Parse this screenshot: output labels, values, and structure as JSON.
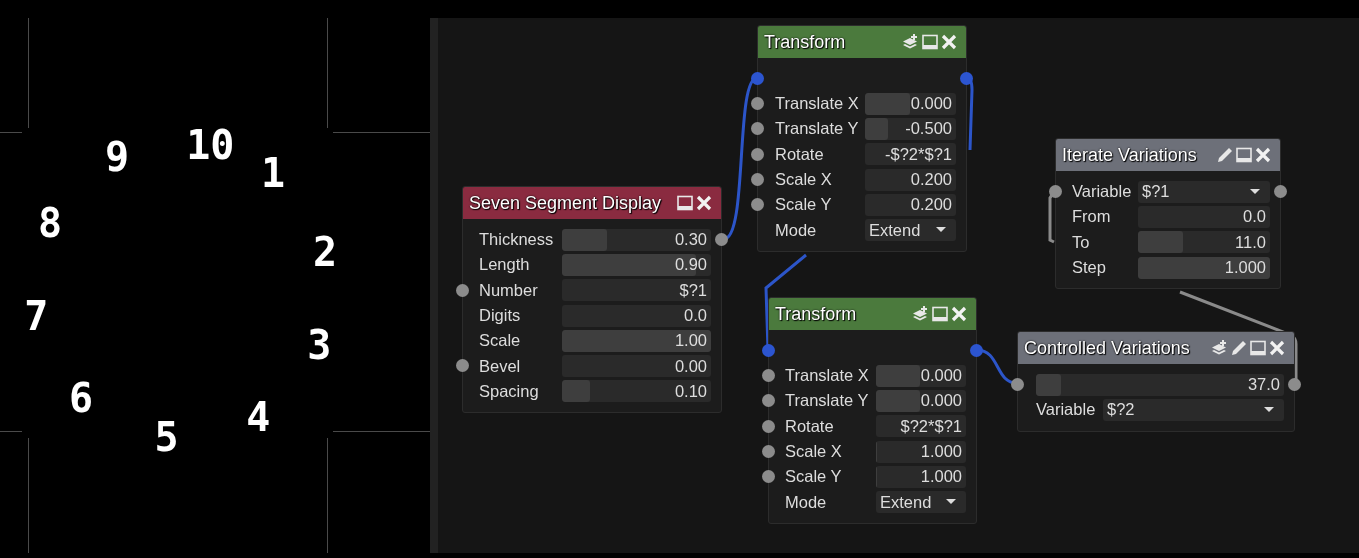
{
  "preview": {
    "digits": [
      "1",
      "2",
      "3",
      "4",
      "5",
      "6",
      "7",
      "8",
      "9",
      "10"
    ]
  },
  "nodes": [
    {
      "title": "Transform",
      "color": "#4b7a3d",
      "icons": [
        {
          "kind": "layers"
        },
        {
          "kind": "window"
        },
        {
          "kind": "close"
        }
      ],
      "flow_in": true,
      "flow_out": true,
      "rows": [
        {
          "kind": "slider",
          "label": "Translate X",
          "value": "0.000",
          "level": 0.49,
          "input": true,
          "output": false
        },
        {
          "kind": "slider",
          "label": "Translate Y",
          "value": "-0.500",
          "level": 0.25,
          "input": true,
          "output": false
        },
        {
          "kind": "text",
          "label": "Rotate",
          "value": "-$?2*$?1",
          "input": true,
          "output": false
        },
        {
          "kind": "slider",
          "label": "Scale X",
          "value": "0.200",
          "input": true,
          "output": false
        },
        {
          "kind": "slider",
          "label": "Scale Y",
          "value": "0.200",
          "input": true,
          "output": false
        },
        {
          "kind": "dropdown",
          "label": "Mode",
          "value": "Extend",
          "input": false,
          "output": false
        }
      ]
    },
    {
      "title": "Seven Segment Display",
      "color": "#8a2b40",
      "icons": [
        {
          "kind": "window"
        },
        {
          "kind": "close"
        }
      ],
      "flow_in": false,
      "flow_out": false,
      "rows": [
        {
          "kind": "slider",
          "label": "Thickness",
          "value": "0.30",
          "level": 0.3,
          "input": false,
          "output": true
        },
        {
          "kind": "slider",
          "label": "Length",
          "value": "0.90",
          "level": 0.9,
          "input": false,
          "output": false
        },
        {
          "kind": "text",
          "label": "Number",
          "value": "$?1",
          "input": true,
          "output": false
        },
        {
          "kind": "slider",
          "label": "Digits",
          "value": "0.0",
          "input": false,
          "output": false
        },
        {
          "kind": "slider",
          "label": "Scale",
          "value": "1.00",
          "level": 1,
          "input": false,
          "output": false
        },
        {
          "kind": "slider",
          "label": "Bevel",
          "value": "0.00",
          "input": true,
          "output": false
        },
        {
          "kind": "slider",
          "label": "Spacing",
          "value": "0.10",
          "level": 0.19,
          "input": false,
          "output": false
        }
      ]
    },
    {
      "title": "Transform",
      "color": "#4b7a3d",
      "icons": [
        {
          "kind": "layers"
        },
        {
          "kind": "window"
        },
        {
          "kind": "close"
        }
      ],
      "flow_in": true,
      "flow_out": true,
      "rows": [
        {
          "kind": "slider",
          "label": "Translate X",
          "value": "0.000",
          "level": 0.49,
          "input": true,
          "output": false
        },
        {
          "kind": "slider",
          "label": "Translate Y",
          "value": "0.000",
          "level": 0.49,
          "input": true,
          "output": false
        },
        {
          "kind": "text",
          "label": "Rotate",
          "value": "$?2*$?1",
          "input": true,
          "output": false
        },
        {
          "kind": "slider",
          "label": "Scale X",
          "value": "1.000",
          "level": 0.01,
          "input": true,
          "output": false
        },
        {
          "kind": "slider",
          "label": "Scale Y",
          "value": "1.000",
          "level": 0.01,
          "input": true,
          "output": false
        },
        {
          "kind": "dropdown",
          "label": "Mode",
          "value": "Extend",
          "input": false,
          "output": false
        }
      ]
    },
    {
      "title": "Iterate Variations",
      "color": "#6d7079",
      "icons": [
        {
          "kind": "edit"
        },
        {
          "kind": "window"
        },
        {
          "kind": "close"
        }
      ],
      "flow_in": false,
      "flow_out": false,
      "rows": [
        {
          "kind": "dropdown",
          "label": "Variable",
          "value": "$?1",
          "input": true,
          "output": true
        },
        {
          "kind": "slider",
          "label": "From",
          "value": "0.0",
          "input": false,
          "output": false
        },
        {
          "kind": "slider",
          "label": "To",
          "value": "11.0",
          "level": 0.34,
          "input": false,
          "output": false
        },
        {
          "kind": "slider",
          "label": "Step",
          "value": "1.000",
          "level": 1,
          "input": false,
          "output": false
        }
      ]
    },
    {
      "title": "Controlled Variations",
      "color": "#6d7079",
      "icons": [
        {
          "kind": "layers"
        },
        {
          "kind": "edit"
        },
        {
          "kind": "window"
        },
        {
          "kind": "close"
        }
      ],
      "flow_in": false,
      "flow_out": false,
      "rows": [
        {
          "kind": "slider",
          "value": "37.0",
          "level": 0.1,
          "input": true,
          "output": true
        },
        {
          "kind": "dropdown",
          "label": "Variable",
          "value": "$?2",
          "input": false,
          "output": false
        }
      ]
    }
  ]
}
